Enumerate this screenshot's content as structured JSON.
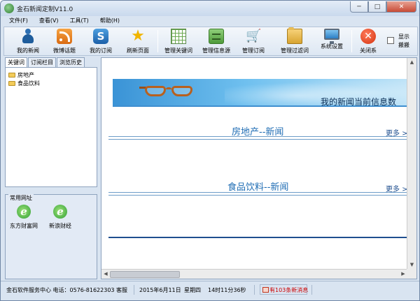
{
  "window": {
    "title": "金石新闻定制V11.0",
    "minimize": "─",
    "maximize": "□",
    "close": "✕"
  },
  "menu": [
    {
      "label": "文件(F)"
    },
    {
      "label": "查看(V)"
    },
    {
      "label": "工具(T)"
    },
    {
      "label": "帮助(H)"
    }
  ],
  "toolbar": {
    "buttons": [
      {
        "label": "我的新闻",
        "icon": "person-icon"
      },
      {
        "label": "微博话题",
        "icon": "rss-icon"
      },
      {
        "label": "我的订阅",
        "icon": "subscribe-icon"
      },
      {
        "label": "刷新页面",
        "icon": "star-icon"
      },
      {
        "label": "管理关键词",
        "icon": "grid-icon"
      },
      {
        "label": "管理信息源",
        "icon": "cabinet-icon"
      },
      {
        "label": "管理订阅",
        "icon": "cart-icon"
      },
      {
        "label": "管理过滤词",
        "icon": "folder-icon"
      },
      {
        "label": "系统设置",
        "icon": "monitor-icon"
      },
      {
        "label": "关闭系",
        "icon": "close-x-icon"
      }
    ],
    "show_count_label": "显示 搬搬",
    "show_count_checked": false,
    "s_glyph": "S",
    "star_glyph": "★",
    "cart_glyph": "🛒",
    "x_glyph": "✕"
  },
  "left_panel": {
    "tabs": [
      {
        "label": "关键词",
        "active": true
      },
      {
        "label": "订阅栏目",
        "active": false
      },
      {
        "label": "浏览历史",
        "active": false
      }
    ],
    "tree_items": [
      "房地产",
      "食品饮料"
    ],
    "favorites_title": "常用网址",
    "favorites": [
      {
        "label": "东方财富网",
        "glyph": "e"
      },
      {
        "label": "新浪财经",
        "glyph": "e"
      }
    ]
  },
  "content": {
    "banner_text": "我的新闻当前信息数",
    "sections": [
      {
        "heading": "房地产--新闻",
        "more": "更多 >"
      },
      {
        "heading": "食品饮料--新闻",
        "more": "更多 >"
      }
    ],
    "scroll_up": "▲",
    "scroll_down": "▼",
    "scroll_left": "◀",
    "scroll_right": "▶"
  },
  "statusbar": {
    "company": "金石软件服务中心 电话：0576-81622303  客服",
    "date": "2015年6月11日",
    "weekday": "星期四",
    "time": "14时11分36秒",
    "new_messages": "有103条新消息"
  },
  "colors": {
    "accent": "#1f6db4",
    "status_alert": "#cc0000"
  }
}
